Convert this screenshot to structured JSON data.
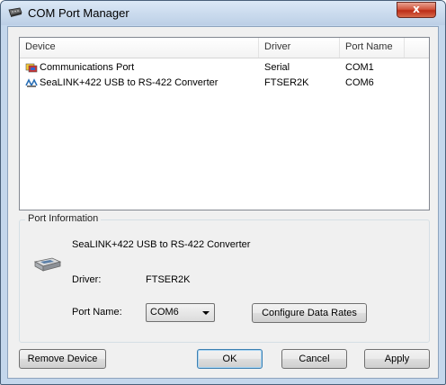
{
  "window": {
    "title": "COM Port Manager",
    "close_glyph": "x",
    "icons": {
      "app": "serial-connector-icon",
      "close": "close-icon"
    }
  },
  "device_list": {
    "columns": [
      "Device",
      "Driver",
      "Port Name"
    ],
    "rows": [
      {
        "device": "Communications Port",
        "driver": "Serial",
        "port": "COM1",
        "icon": "com-port-icon"
      },
      {
        "device": "SeaLINK+422 USB to RS-422 Converter",
        "driver": "FTSER2K",
        "port": "COM6",
        "icon": "usb-serial-converter-icon"
      }
    ]
  },
  "port_info": {
    "group_label": "Port Information",
    "device_name": "SeaLINK+422 USB to RS-422 Converter",
    "driver_label": "Driver:",
    "driver_value": "FTSER2K",
    "port_name_label": "Port Name:",
    "port_name_value": "COM6",
    "device_icon": "serial-device-icon",
    "configure_button": "Configure Data Rates"
  },
  "buttons": {
    "remove": "Remove Device",
    "ok": "OK",
    "cancel": "Cancel",
    "apply": "Apply"
  },
  "colors": {
    "titlebar": "#c4d7ec",
    "close_button": "#c63d27",
    "dialog_background": "#f0f0f0"
  }
}
